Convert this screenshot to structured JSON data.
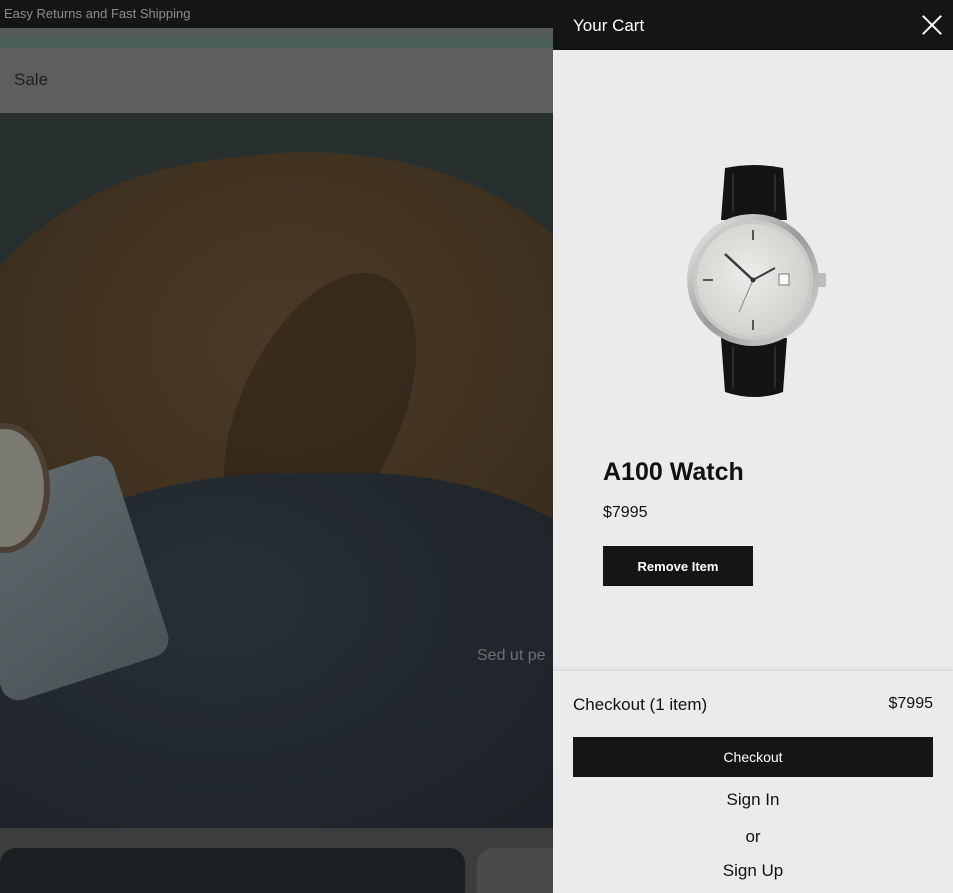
{
  "announcement": {
    "text": "Easy Returns and Fast Shipping"
  },
  "nav": {
    "sale_label": "Sale"
  },
  "hero": {
    "caption_text": "Sed ut pe"
  },
  "cart": {
    "title": "Your Cart",
    "close_icon": "close-icon",
    "item": {
      "name": "A100 Watch",
      "price": "$7995",
      "remove_label": "Remove Item",
      "image_icon": "watch-image"
    },
    "checkout": {
      "count_label": "Checkout (1 item)",
      "total": "$7995",
      "button_label": "Checkout"
    },
    "sign_in_label": "Sign In",
    "or_label": "or",
    "sign_up_label": "Sign Up"
  },
  "colors": {
    "drawer_bg": "#ebebeb",
    "dark": "#151515",
    "text": "#111111"
  }
}
